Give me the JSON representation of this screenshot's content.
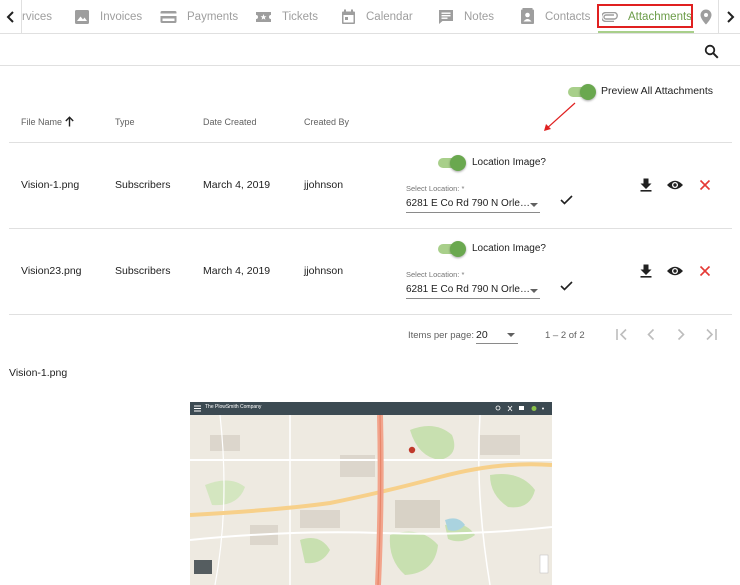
{
  "tabs": [
    {
      "label": "rvices",
      "icon": "services-icon"
    },
    {
      "label": "Invoices",
      "icon": "image-icon"
    },
    {
      "label": "Payments",
      "icon": "credit-card-icon"
    },
    {
      "label": "Tickets",
      "icon": "ticket-icon"
    },
    {
      "label": "Calendar",
      "icon": "calendar-icon"
    },
    {
      "label": "Notes",
      "icon": "comment-icon"
    },
    {
      "label": "Contacts",
      "icon": "contact-card-icon"
    },
    {
      "label": "Attachments",
      "icon": "paperclip-icon",
      "active": true
    },
    {
      "label": "",
      "icon": "location-pin-icon"
    }
  ],
  "preview_all_label": "Preview All Attachments",
  "table": {
    "headers": {
      "file_name": "File Name",
      "type": "Type",
      "date_created": "Date Created",
      "created_by": "Created By"
    },
    "sort_column": "file_name",
    "sort_direction": "ascending",
    "rows": [
      {
        "file_name": "Vision-1.png",
        "type": "Subscribers",
        "date_created": "March 4, 2019",
        "created_by": "jjohnson",
        "location_label": "Location Image?",
        "location_on": true,
        "select_label": "Select Location: *",
        "select_value": "6281 E Co Rd 790 N Orle…"
      },
      {
        "file_name": "Vision23.png",
        "type": "Subscribers",
        "date_created": "March 4, 2019",
        "created_by": "jjohnson",
        "location_label": "Location Image?",
        "location_on": true,
        "select_label": "Select Location: *",
        "select_value": "6281 E Co Rd 790 N Orle…"
      }
    ]
  },
  "paginator": {
    "items_per_page_label": "Items per page:",
    "page_size": "20",
    "range_label": "1 – 2 of 2"
  },
  "preview": {
    "file_name": "Vision-1.png",
    "map_title": "The PlowSmith Company"
  },
  "colors": {
    "accent_green": "#6aa84f",
    "toggle_track": "#a8cf8a",
    "delete_red": "#e53935",
    "highlight_box": "#e02020",
    "annotation_arrow": "#e02020"
  }
}
